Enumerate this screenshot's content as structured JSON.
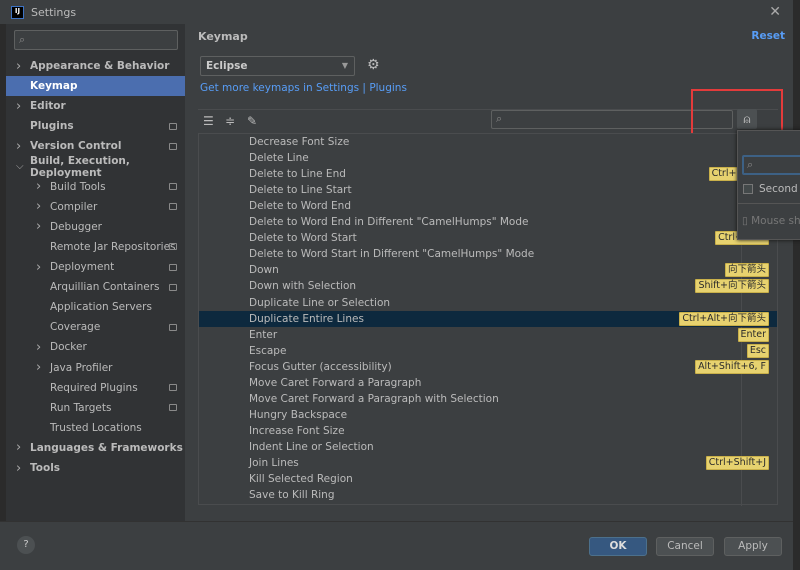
{
  "window": {
    "title": "Settings",
    "logo_text": "IJ",
    "close_icon": "close-icon"
  },
  "sidebar": {
    "search_placeholder": "",
    "items": [
      {
        "label": "Appearance & Behavior",
        "level": 0,
        "arrow": "right",
        "bold": true
      },
      {
        "label": "Keymap",
        "level": 0,
        "arrow": "",
        "bold": true,
        "selected": true
      },
      {
        "label": "Editor",
        "level": 0,
        "arrow": "right",
        "bold": true
      },
      {
        "label": "Plugins",
        "level": 0,
        "arrow": "",
        "bold": true,
        "project_icon": true
      },
      {
        "label": "Version Control",
        "level": 0,
        "arrow": "right",
        "bold": true,
        "project_icon": true
      },
      {
        "label": "Build, Execution, Deployment",
        "level": 0,
        "arrow": "down",
        "bold": true
      },
      {
        "label": "Build Tools",
        "level": 1,
        "arrow": "right",
        "project_icon": true
      },
      {
        "label": "Compiler",
        "level": 1,
        "arrow": "right",
        "project_icon": true
      },
      {
        "label": "Debugger",
        "level": 1,
        "arrow": "right"
      },
      {
        "label": "Remote Jar Repositories",
        "level": 1,
        "arrow": "",
        "project_icon": true
      },
      {
        "label": "Deployment",
        "level": 1,
        "arrow": "right",
        "project_icon": true
      },
      {
        "label": "Arquillian Containers",
        "level": 1,
        "arrow": "",
        "project_icon": true
      },
      {
        "label": "Application Servers",
        "level": 1,
        "arrow": ""
      },
      {
        "label": "Coverage",
        "level": 1,
        "arrow": "",
        "project_icon": true
      },
      {
        "label": "Docker",
        "level": 1,
        "arrow": "right"
      },
      {
        "label": "Java Profiler",
        "level": 1,
        "arrow": "right"
      },
      {
        "label": "Required Plugins",
        "level": 1,
        "arrow": "",
        "project_icon": true
      },
      {
        "label": "Run Targets",
        "level": 1,
        "arrow": "",
        "project_icon": true
      },
      {
        "label": "Trusted Locations",
        "level": 1,
        "arrow": ""
      },
      {
        "label": "Languages & Frameworks",
        "level": 0,
        "arrow": "right",
        "bold": true
      },
      {
        "label": "Tools",
        "level": 0,
        "arrow": "right",
        "bold": true
      }
    ]
  },
  "main": {
    "heading": "Keymap",
    "reset": "Reset",
    "keymap_selected": "Eclipse",
    "links": {
      "text": "Get more keymaps in Settings",
      "sep": " | ",
      "plugins": "Plugins"
    },
    "filter_placeholder": "",
    "actions": [
      {
        "name": "Decrease Font Size",
        "shortcut": ""
      },
      {
        "name": "Delete Line",
        "shortcut": ""
      },
      {
        "name": "Delete to Line End",
        "shortcut": "Ctrl+Shift+"
      },
      {
        "name": "Delete to Line Start",
        "shortcut": ""
      },
      {
        "name": "Delete to Word End",
        "shortcut": "Ctrl+"
      },
      {
        "name": "Delete to Word End in Different \"CamelHumps\" Mode",
        "shortcut": ""
      },
      {
        "name": "Delete to Word Start",
        "shortcut": "Ctrl+Back"
      },
      {
        "name": "Delete to Word Start in Different \"CamelHumps\" Mode",
        "shortcut": ""
      },
      {
        "name": "Down",
        "shortcut": "向下箭头"
      },
      {
        "name": "Down with Selection",
        "shortcut": "Shift+向下箭头"
      },
      {
        "name": "Duplicate Line or Selection",
        "shortcut": ""
      },
      {
        "name": "Duplicate Entire Lines",
        "shortcut": "Ctrl+Alt+向下箭头",
        "selected": true
      },
      {
        "name": "Enter",
        "shortcut": "Enter"
      },
      {
        "name": "Escape",
        "shortcut": "Esc"
      },
      {
        "name": "Focus Gutter (accessibility)",
        "shortcut": "Alt+Shift+6, F"
      },
      {
        "name": "Move Caret Forward a Paragraph",
        "shortcut": ""
      },
      {
        "name": "Move Caret Forward a Paragraph with Selection",
        "shortcut": ""
      },
      {
        "name": "Hungry Backspace",
        "shortcut": ""
      },
      {
        "name": "Increase Font Size",
        "shortcut": ""
      },
      {
        "name": "Indent Line or Selection",
        "shortcut": ""
      },
      {
        "name": "Join Lines",
        "shortcut": "Ctrl+Shift+J"
      },
      {
        "name": "Kill Selected Region",
        "shortcut": ""
      },
      {
        "name": "Save to Kill Ring",
        "shortcut": ""
      }
    ]
  },
  "popup": {
    "second_stroke": "Second s",
    "mouse_shortcut": "Mouse sh"
  },
  "footer": {
    "help": "?",
    "ok": "OK",
    "cancel": "Cancel",
    "apply": "Apply"
  },
  "colors": {
    "selection": "#4b6eaf",
    "row_selection": "#0d293e",
    "shortcut_badge": "#e7d26f",
    "link": "#589df6",
    "highlight_box": "#e33b3b"
  }
}
